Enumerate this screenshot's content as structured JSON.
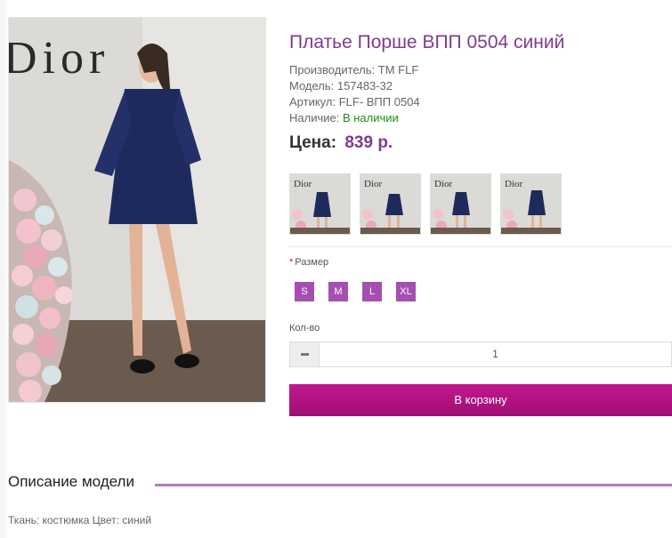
{
  "product": {
    "title": "Платье Порше ВПП 0504 синий",
    "meta": [
      {
        "label": "Производитель:",
        "value": "TM FLF"
      },
      {
        "label": "Модель:",
        "value": "157483-32"
      },
      {
        "label": "Артикул:",
        "value": "FLF- ВПП 0504"
      },
      {
        "label": "Наличие:",
        "value": "В наличии"
      }
    ],
    "price_label": "Цена:",
    "price": "839 р.",
    "image_brand_text": "Dior",
    "thumb_brand_text": "Dior"
  },
  "options": {
    "size_required_mark": "*",
    "size_label": "Размер",
    "sizes": [
      "S",
      "M",
      "L",
      "XL"
    ],
    "qty_label": "Кол-во",
    "qty_value": "1"
  },
  "cart_button": "В корзину",
  "description": {
    "title": "Описание модели",
    "text": "Ткань: костюмка Цвет: синий"
  },
  "colors": {
    "accent": "#7d3c8f",
    "size_button": "#a64fb2",
    "cart_button": "#b3157f",
    "in_stock": "#1a8f1a"
  }
}
